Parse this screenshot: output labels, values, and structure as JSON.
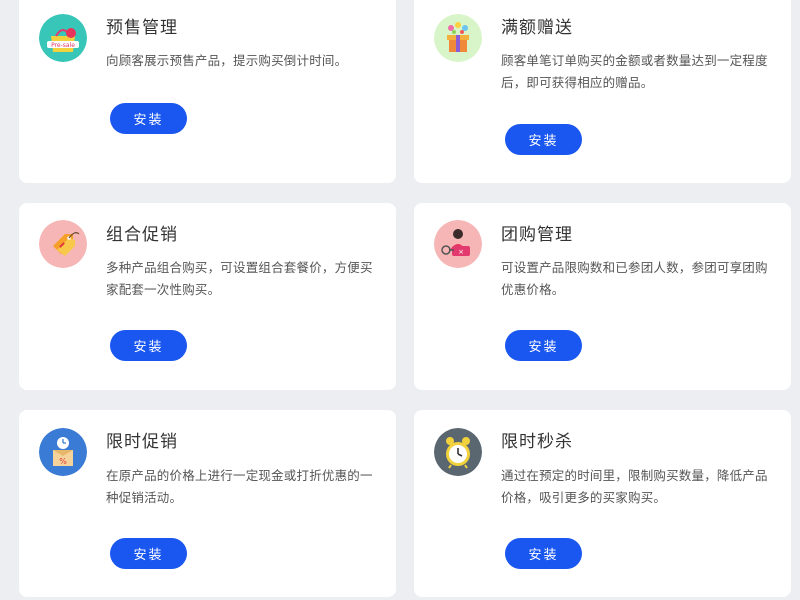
{
  "plugins": [
    {
      "title": "预售管理",
      "description": "向顾客展示预售产品，提示购买倒计时间。",
      "button": "安装",
      "icon": "pre-sale-icon",
      "icon_text": "Pre-sale"
    },
    {
      "title": "满额赠送",
      "description": "顾客单笔订单购买的金额或者数量达到一定程度后，即可获得相应的赠品。",
      "button": "安装",
      "icon": "gift-icon"
    },
    {
      "title": "组合促销",
      "description": "多种产品组合购买，可设置组合套餐价，方便买家配套一次性购买。",
      "button": "安装",
      "icon": "price-tag-icon"
    },
    {
      "title": "团购管理",
      "description": "可设置产品限购数和已参团人数，参团可享团购优惠价格。",
      "button": "安装",
      "icon": "group-buy-icon"
    },
    {
      "title": "限时促销",
      "description": "在原产品的价格上进行一定现金或打折优惠的一种促销活动。",
      "button": "安装",
      "icon": "timed-discount-icon",
      "icon_text": "%"
    },
    {
      "title": "限时秒杀",
      "description": "通过在预定的时间里，限制购买数量，降低产品价格，吸引更多的买家购买。",
      "button": "安装",
      "icon": "alarm-clock-icon"
    }
  ],
  "colors": {
    "page_background": "#eceef2",
    "card_background": "#ffffff",
    "button": "#1a56f0"
  }
}
